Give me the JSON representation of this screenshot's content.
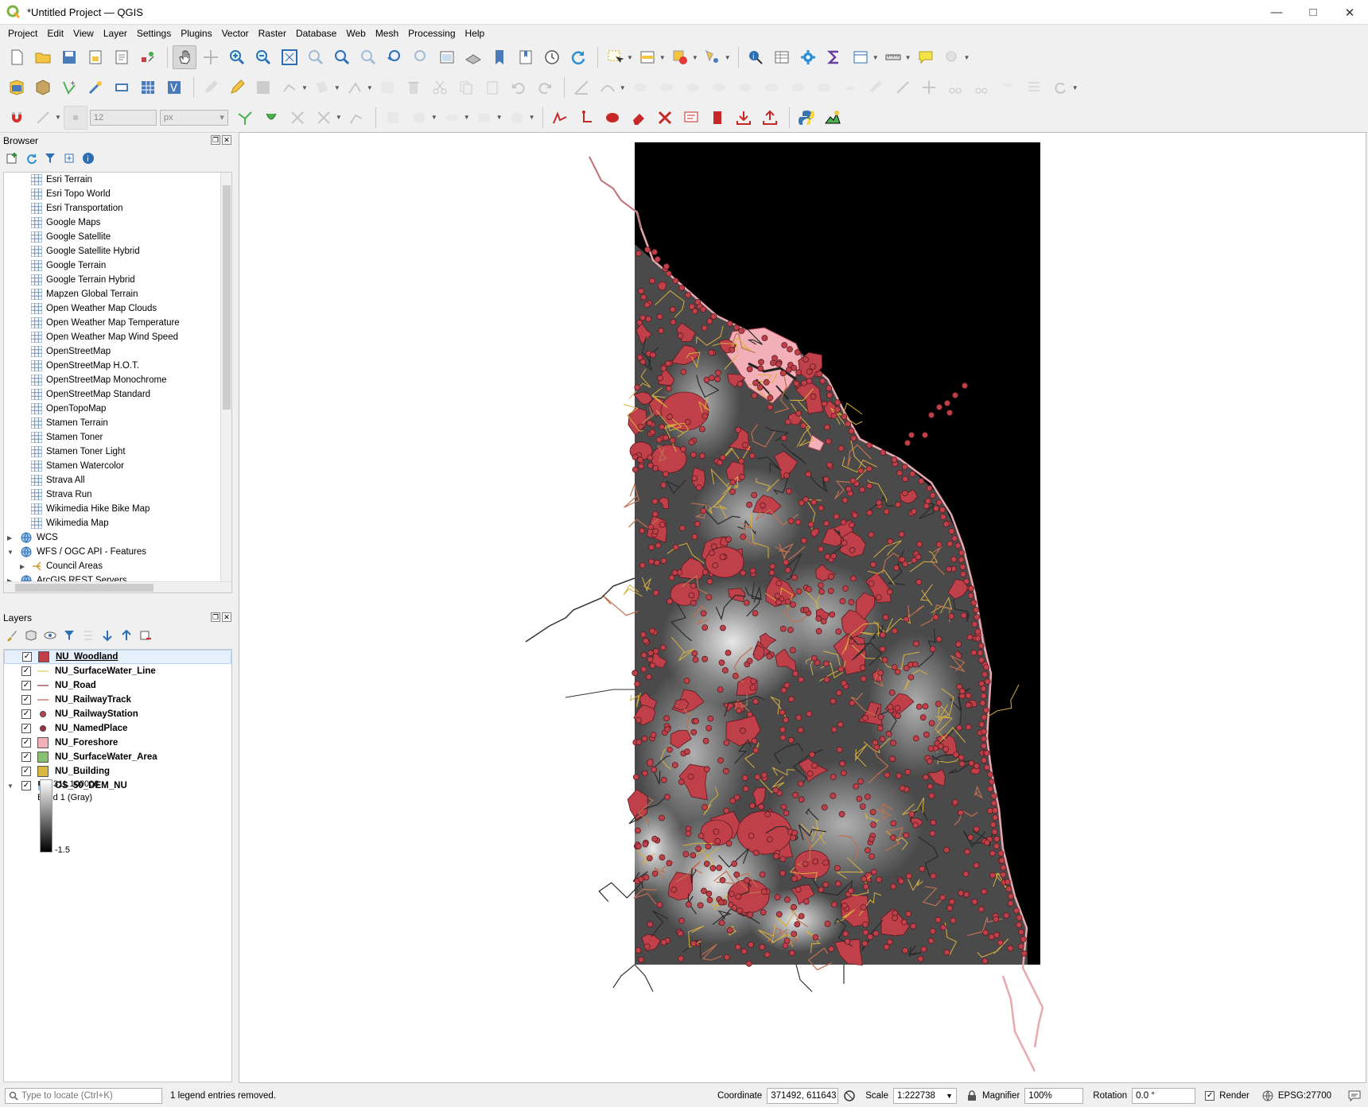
{
  "window": {
    "title": "*Untitled Project — QGIS"
  },
  "menu": [
    "Project",
    "Edit",
    "View",
    "Layer",
    "Settings",
    "Plugins",
    "Vector",
    "Raster",
    "Database",
    "Web",
    "Mesh",
    "Processing",
    "Help"
  ],
  "snapping": {
    "tolerance": "12",
    "unit": "px"
  },
  "browser": {
    "title": "Browser",
    "xyz_tiles": [
      "Esri Terrain",
      "Esri Topo World",
      "Esri Transportation",
      "Google Maps",
      "Google Satellite",
      "Google Satellite Hybrid",
      "Google Terrain",
      "Google Terrain Hybrid",
      "Mapzen Global Terrain",
      "Open Weather Map Clouds",
      "Open Weather Map Temperature",
      "Open Weather Map Wind Speed",
      "OpenStreetMap",
      "OpenStreetMap H.O.T.",
      "OpenStreetMap Monochrome",
      "OpenStreetMap Standard",
      "OpenTopoMap",
      "Stamen Terrain",
      "Stamen Toner",
      "Stamen Toner Light",
      "Stamen Watercolor",
      "Strava All",
      "Strava Run",
      "Wikimedia Hike Bike Map",
      "Wikimedia Map"
    ],
    "wcs": "WCS",
    "wfs": "WFS / OGC API - Features",
    "wfs_child": "Council Areas",
    "arcgis": "ArcGIS REST Servers"
  },
  "layers": {
    "title": "Layers",
    "items": [
      {
        "name": "NU_Woodland",
        "symbol": "fill",
        "color": "#c0404a"
      },
      {
        "name": "NU_SurfaceWater_Line",
        "symbol": "line",
        "color": "#e6d27a"
      },
      {
        "name": "NU_Road",
        "symbol": "line",
        "color": "#a06060"
      },
      {
        "name": "NU_RailwayTrack",
        "symbol": "line",
        "color": "#d08080"
      },
      {
        "name": "NU_RailwayStation",
        "symbol": "point",
        "color": "#c0404a"
      },
      {
        "name": "NU_NamedPlace",
        "symbol": "point",
        "color": "#a03040"
      },
      {
        "name": "NU_Foreshore",
        "symbol": "fill",
        "color": "#f4b0b8"
      },
      {
        "name": "NU_SurfaceWater_Area",
        "symbol": "fill",
        "color": "#88c070"
      },
      {
        "name": "NU_Building",
        "symbol": "fill",
        "color": "#d8b840"
      }
    ],
    "raster": {
      "name": "OS_50_DEM_NU",
      "band": "Band 1 (Gray)",
      "max": "311.100006",
      "min": "-1.5"
    }
  },
  "status": {
    "locate_placeholder": "Type to locate (Ctrl+K)",
    "message": "1 legend entries removed.",
    "coordinate_label": "Coordinate",
    "coordinate": "371492, 611643",
    "scale_label": "Scale",
    "scale": "1:222738",
    "magnifier_label": "Magnifier",
    "magnifier": "100%",
    "rotation_label": "Rotation",
    "rotation": "0.0 °",
    "render_label": "Render",
    "crs": "EPSG:27700"
  }
}
